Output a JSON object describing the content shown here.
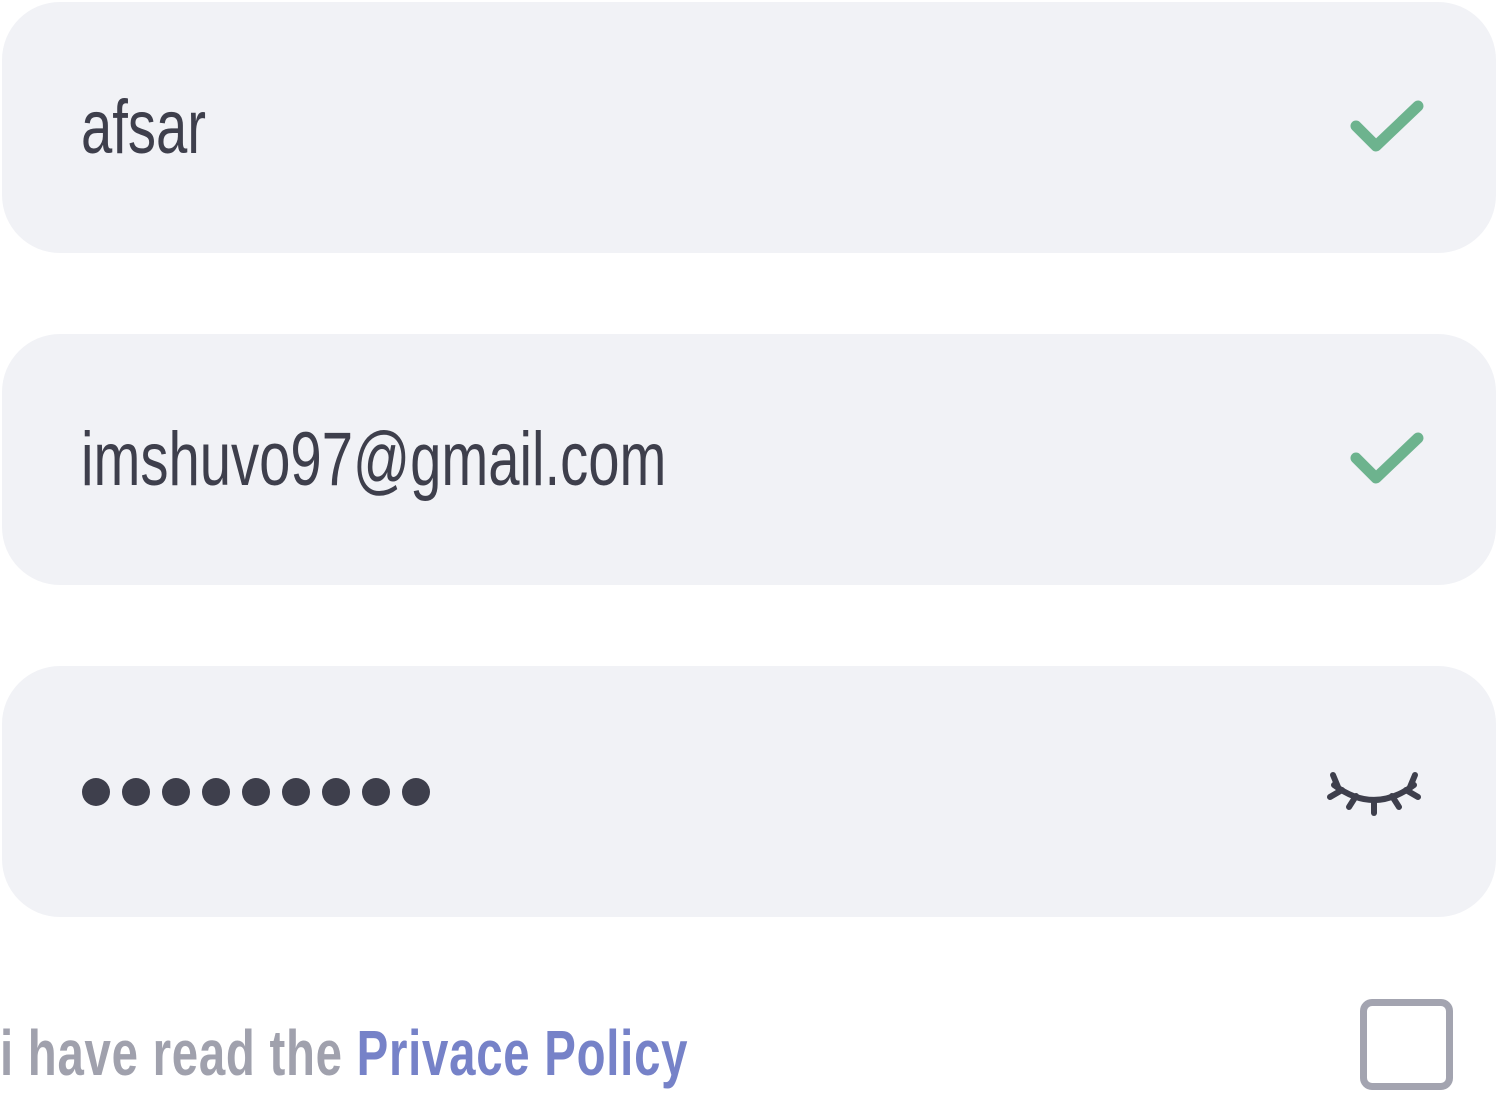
{
  "form": {
    "name_field": {
      "value": "afsar",
      "status_icon": "check-icon"
    },
    "email_field": {
      "value": "imshuvo97@gmail.com",
      "status_icon": "check-icon"
    },
    "password_field": {
      "masked_value": "••••••••••",
      "visibility_icon": "eye-closed-icon"
    },
    "consent": {
      "text": "i have read the ",
      "link_text": "Privace Policy",
      "checked": false
    }
  },
  "colors": {
    "field_background": "#f1f2f6",
    "text": "#3e3f4c",
    "success": "#6db38e",
    "muted_text": "#a0a1ad",
    "link": "#7682c8",
    "checkbox_border": "#a3a4b0"
  }
}
